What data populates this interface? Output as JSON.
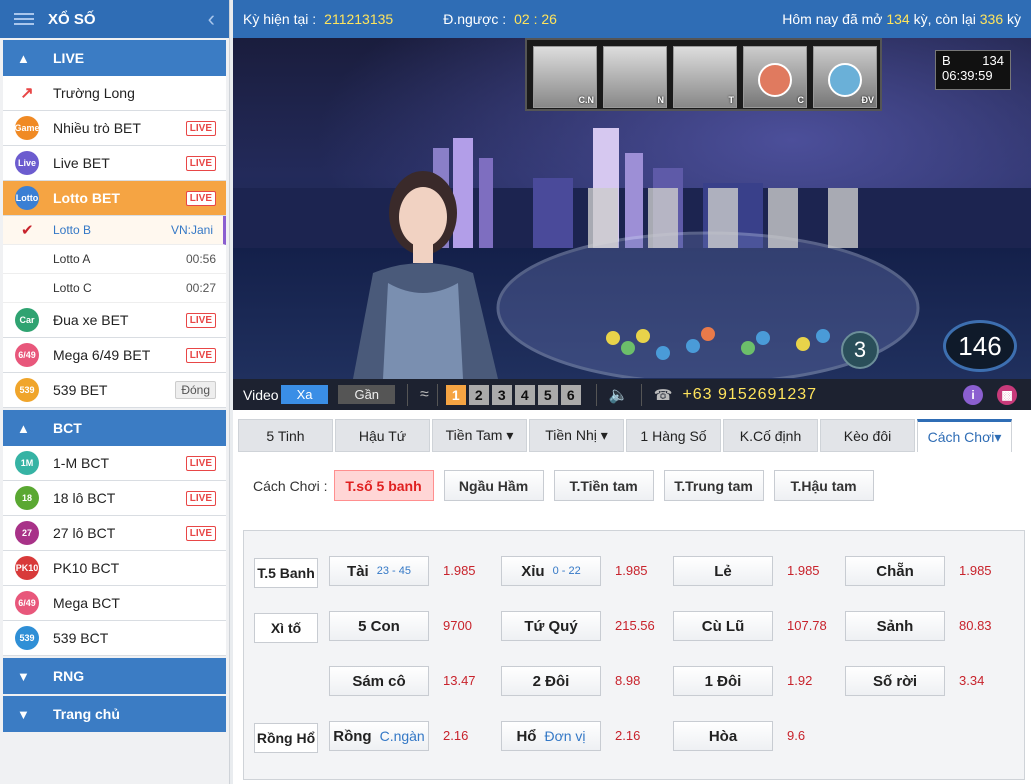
{
  "sidebar": {
    "title": "XỔ SỐ",
    "sections": {
      "live": "LIVE",
      "bct": "BCT",
      "rng": "RNG",
      "trangchu": "Trang chủ"
    },
    "live_items": [
      {
        "label": "Trường Long",
        "icon": "trend-up-icon",
        "color": "#e84646",
        "badge": ""
      },
      {
        "label": "Nhiều trò BET",
        "icon": "Game",
        "color": "#f08a24",
        "badge": "LIVE"
      },
      {
        "label": "Live BET",
        "icon": "Live",
        "color": "#6c5ccf",
        "badge": "LIVE"
      },
      {
        "label": "Lotto BET",
        "icon": "Lotto",
        "color": "#3a7fd4",
        "badge": "LIVE"
      }
    ],
    "lotto_sub": [
      {
        "label": "Lotto B",
        "time": "VN:Jani"
      },
      {
        "label": "Lotto A",
        "time": "00:56"
      },
      {
        "label": "Lotto C",
        "time": "00:27"
      }
    ],
    "live_items2": [
      {
        "label": "Đua xe BET",
        "icon": "Car",
        "color": "#2fa371",
        "badge": "LIVE"
      },
      {
        "label": "Mega 6/49 BET",
        "icon": "6/49",
        "color": "#e8577b",
        "badge": "LIVE"
      },
      {
        "label": "539 BET",
        "icon": "539",
        "color": "#f0a52b",
        "badge": "Đóng"
      }
    ],
    "bct_items": [
      {
        "label": "1-M BCT",
        "icon": "1M",
        "color": "#36b3a4",
        "badge": "LIVE"
      },
      {
        "label": "18 lô BCT",
        "icon": "18",
        "color": "#5aa832",
        "badge": "LIVE"
      },
      {
        "label": "27 lô BCT",
        "icon": "27",
        "color": "#a83288",
        "badge": "LIVE"
      },
      {
        "label": "PK10 BCT",
        "icon": "PK10",
        "color": "#d83a3a",
        "badge": ""
      },
      {
        "label": "Mega BCT",
        "icon": "6/49",
        "color": "#e8577b",
        "badge": ""
      },
      {
        "label": "539 BCT",
        "icon": "539",
        "color": "#2f8fd6",
        "badge": ""
      }
    ]
  },
  "topbar": {
    "ky_label": "Kỳ hiện tại :",
    "ky_value": "211213135",
    "countdown_label": "Đ.ngược :",
    "countdown_value": "02 : 26",
    "today_prefix": "Hôm nay đã mở",
    "opened": "134",
    "mid": "kỳ, còn lại",
    "remaining": "336",
    "suffix": "kỳ"
  },
  "video": {
    "tubes": [
      "C.N",
      "N",
      "T",
      "C",
      "ĐV"
    ],
    "clock_code": "B",
    "clock_round": "134",
    "clock_time": "06:39:59",
    "ball_number": "3",
    "counter": "146",
    "label": "Video",
    "far": "Xa",
    "near": "Gần",
    "cams": [
      "1",
      "2",
      "3",
      "4",
      "5",
      "6"
    ],
    "phone": "+63 9152691237"
  },
  "tabs": [
    "5 Tinh",
    "Hậu Tứ",
    "Tiền Tam ▾",
    "Tiền Nhị ▾",
    "1 Hàng Số",
    "K.Cố định",
    "Kèo đôi",
    "Cách Chơi▾"
  ],
  "modes": {
    "label": "Cách Chơi :",
    "buttons": [
      "T.số 5 banh",
      "Ngầu Hầm",
      "T.Tiền tam",
      "T.Trung tam",
      "T.Hậu tam"
    ]
  },
  "rows": {
    "labels": [
      "T.5 Banh",
      "Xì tố",
      "Rồng Hổ"
    ],
    "bets": [
      [
        {
          "name": "Tài",
          "sub": "23 - 45",
          "odd": "1.985"
        },
        {
          "name": "Xỉu",
          "sub": "0 - 22",
          "odd": "1.985"
        },
        {
          "name": "Lẻ",
          "sub": "",
          "odd": "1.985"
        },
        {
          "name": "Chẵn",
          "sub": "",
          "odd": "1.985"
        }
      ],
      [
        {
          "name": "5 Con",
          "sub": "",
          "odd": "9700"
        },
        {
          "name": "Tứ Quý",
          "sub": "",
          "odd": "215.56"
        },
        {
          "name": "Cù Lũ",
          "sub": "",
          "odd": "107.78"
        },
        {
          "name": "Sảnh",
          "sub": "",
          "odd": "80.83"
        }
      ],
      [
        {
          "name": "Sám cô",
          "sub": "",
          "odd": "13.47"
        },
        {
          "name": "2 Đôi",
          "sub": "",
          "odd": "8.98"
        },
        {
          "name": "1 Đôi",
          "sub": "",
          "odd": "1.92"
        },
        {
          "name": "Số rời",
          "sub": "",
          "odd": "3.34"
        }
      ],
      [
        {
          "name": "Rồng",
          "sub": "C.ngàn",
          "odd": "2.16"
        },
        {
          "name": "Hổ",
          "sub": "Đơn vị",
          "odd": "2.16"
        },
        {
          "name": "Hòa",
          "sub": "",
          "odd": "9.6"
        }
      ]
    ]
  }
}
